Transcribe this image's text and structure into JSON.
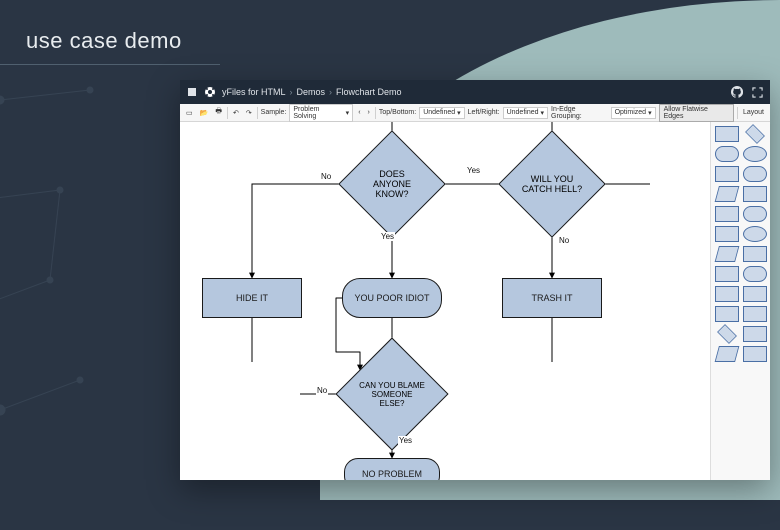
{
  "page_title": "use case demo",
  "header": {
    "product": "yFiles for HTML",
    "crumbs": [
      "Demos",
      "Flowchart Demo"
    ]
  },
  "toolbar": {
    "sample_label": "Sample:",
    "sample_value": "Problem Solving",
    "topbottom_label": "Top/Bottom:",
    "topbottom_value": "Undefined",
    "leftright_label": "Left/Right:",
    "leftright_value": "Undefined",
    "inedge_label": "In-Edge Grouping:",
    "inedge_value": "Optimized",
    "flatwise_toggle": "Allow Flatwise Edges",
    "layout_btn": "Layout"
  },
  "flowchart": {
    "nodes": {
      "does_anyone_know": "DOES ANYONE KNOW?",
      "catch_hell": "WILL YOU CATCH HELL?",
      "hide_it": "HIDE IT",
      "poor_idiot": "YOU POOR IDIOT",
      "trash_it": "TRASH IT",
      "blame": "CAN YOU BLAME SOMEONE ELSE?",
      "no_problem": "NO PROBLEM"
    },
    "labels": {
      "yes": "Yes",
      "no": "No"
    }
  },
  "chart_data": {
    "type": "flowchart",
    "nodes": [
      {
        "id": "does_anyone_know",
        "shape": "decision",
        "label": "DOES ANYONE KNOW?"
      },
      {
        "id": "catch_hell",
        "shape": "decision",
        "label": "WILL YOU CATCH HELL?"
      },
      {
        "id": "hide_it",
        "shape": "process",
        "label": "HIDE IT"
      },
      {
        "id": "poor_idiot",
        "shape": "terminator",
        "label": "YOU POOR IDIOT"
      },
      {
        "id": "trash_it",
        "shape": "process",
        "label": "TRASH IT"
      },
      {
        "id": "blame",
        "shape": "decision",
        "label": "CAN YOU BLAME SOMEONE ELSE?"
      },
      {
        "id": "no_problem",
        "shape": "terminator",
        "label": "NO PROBLEM"
      }
    ],
    "edges": [
      {
        "from": "does_anyone_know",
        "to": "hide_it",
        "label": "No"
      },
      {
        "from": "does_anyone_know",
        "to": "catch_hell",
        "label": "Yes"
      },
      {
        "from": "does_anyone_know",
        "to": "poor_idiot",
        "label": "Yes"
      },
      {
        "from": "catch_hell",
        "to": "trash_it",
        "label": "No"
      },
      {
        "from": "poor_idiot",
        "to": "blame",
        "label": ""
      },
      {
        "from": "blame",
        "to": "no_problem",
        "label": "Yes"
      },
      {
        "from": "blame",
        "to": "hide_it",
        "label": "No"
      }
    ]
  }
}
